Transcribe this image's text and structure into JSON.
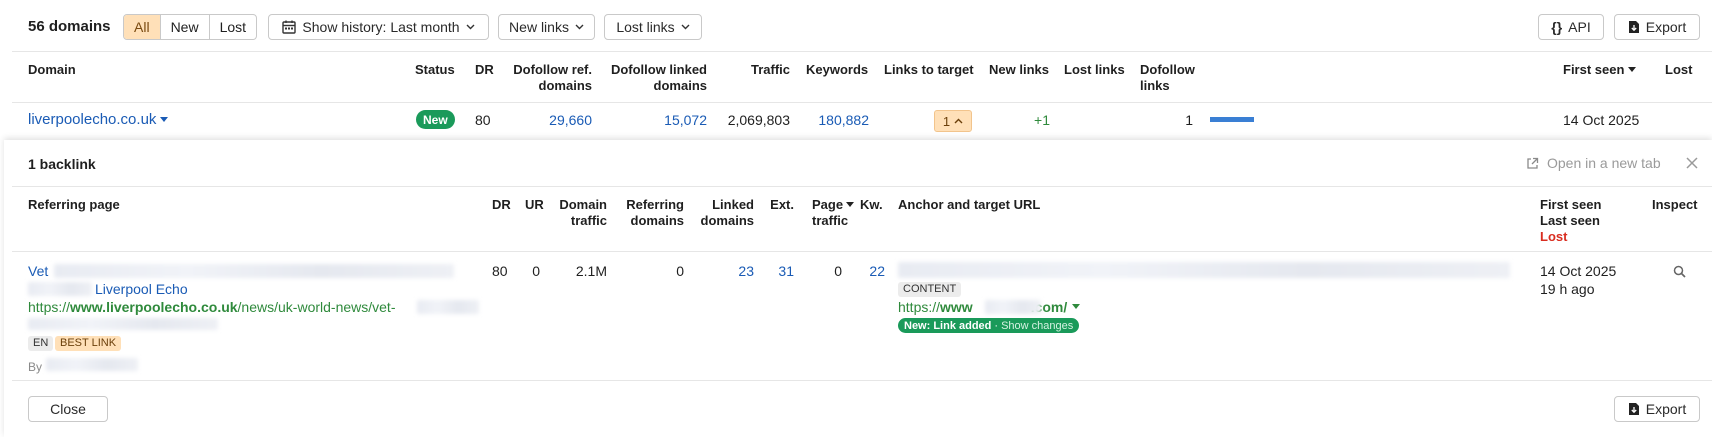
{
  "toolbar": {
    "domains_count": "56 domains",
    "filters": [
      "All",
      "New",
      "Lost"
    ],
    "history_label": "Show history: Last month",
    "new_links_label": "New links",
    "lost_links_label": "Lost links",
    "api_label": "API",
    "export_label": "Export"
  },
  "table": {
    "headers": {
      "domain": "Domain",
      "status": "Status",
      "dr": "DR",
      "dofollow_ref_l1": "Dofollow ref.",
      "dofollow_ref_l2": "domains",
      "dofollow_linked_l1": "Dofollow linked",
      "dofollow_linked_l2": "domains",
      "traffic": "Traffic",
      "keywords": "Keywords",
      "links_to_target": "Links to target",
      "new_links": "New links",
      "lost_links": "Lost links",
      "dofollow_links_l1": "Dofollow",
      "dofollow_links_l2": "links",
      "first_seen": "First seen",
      "lost": "Lost"
    },
    "row": {
      "domain": "liverpoolecho.co.uk",
      "status": "New",
      "dr": "80",
      "dofollow_ref": "29,660",
      "dofollow_linked": "15,072",
      "traffic": "2,069,803",
      "keywords": "180,882",
      "links_to_target": "1",
      "new_links": "+1",
      "dofollow_links": "1",
      "dofollow_links_bar_fraction": 1.0,
      "first_seen": "14 Oct 2025"
    }
  },
  "panel": {
    "title": "1 backlink",
    "open_new_tab": "Open in a new tab",
    "headers": {
      "referring_page": "Referring page",
      "dr": "DR",
      "ur": "UR",
      "domain_traffic_l1": "Domain",
      "domain_traffic_l2": "traffic",
      "referring_domains_l1": "Referring",
      "referring_domains_l2": "domains",
      "linked_domains_l1": "Linked",
      "linked_domains_l2": "domains",
      "ext": "Ext.",
      "page_traffic_l1": "Page",
      "page_traffic_l2": "traffic",
      "kw": "Kw.",
      "anchor": "Anchor and target URL",
      "first_seen": "First seen",
      "last_seen": "Last seen",
      "lost": "Lost",
      "inspect": "Inspect"
    },
    "row": {
      "title_start": "Vet",
      "site_name": "Liverpool Echo",
      "url_prefix": "https://",
      "url_domain": "www.liverpoolecho.co.uk",
      "url_path": "/news/uk-world-news/vet-",
      "tag_lang": "EN",
      "tag_best": "BEST LINK",
      "by_label": "By",
      "dr": "80",
      "ur": "0",
      "domain_traffic": "2.1M",
      "referring_domains": "0",
      "linked_domains": "23",
      "ext": "31",
      "page_traffic": "0",
      "kw": "22",
      "content_tag": "CONTENT",
      "target_prefix": "https://",
      "target_www": "www",
      "target_tld": ".com/",
      "new_badge": "New: Link added",
      "show_changes": "Show changes",
      "first_seen": "14 Oct 2025",
      "last_seen": "19 h ago"
    },
    "close_label": "Close",
    "export_label": "Export"
  },
  "colors": {
    "accent_blue": "#1a5bb5",
    "green": "#2f8a3c",
    "status_new": "#1a9a5a",
    "lost_red": "#d92d20",
    "active_filter": "#ffe0b8"
  }
}
